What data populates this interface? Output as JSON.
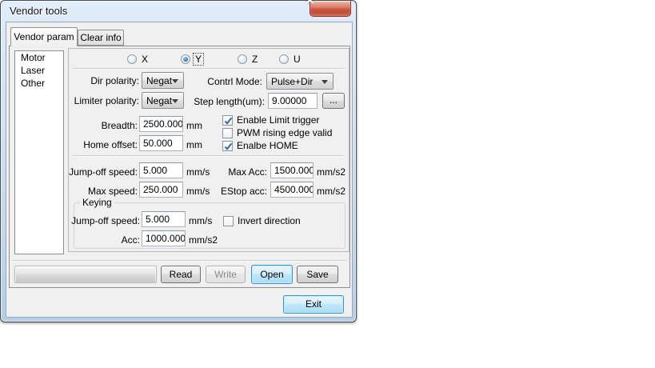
{
  "window": {
    "title": "Vendor tools"
  },
  "icons": {
    "close": "x-cross",
    "dropdown": "triangle-down",
    "checkbox_check": "checkmark"
  },
  "tabs": [
    {
      "label": "Vendor param"
    },
    {
      "label": "Clear info"
    }
  ],
  "sidebar": {
    "items": [
      "Motor",
      "Laser",
      "Other"
    ]
  },
  "axes": [
    {
      "label": "X",
      "selected": false
    },
    {
      "label": "Y",
      "selected": true
    },
    {
      "label": "Z",
      "selected": false
    },
    {
      "label": "U",
      "selected": false
    }
  ],
  "fields": {
    "dir_polarity": {
      "label": "Dir polarity:",
      "value": "Negat"
    },
    "contrl_mode": {
      "label": "Contrl Mode:",
      "value": "Pulse+Dir"
    },
    "limiter_polarity": {
      "label": "Limiter polarity:",
      "value": "Negat"
    },
    "step_length": {
      "label": "Step length(um):",
      "value": "9.00000",
      "browse": "..."
    },
    "breadth": {
      "label": "Breadth:",
      "value": "2500.000",
      "unit": "mm"
    },
    "home_offset": {
      "label": "Home offset:",
      "value": "50.000",
      "unit": "mm"
    },
    "jump_off_speed": {
      "label": "Jump-off speed:",
      "value": "5.000",
      "unit": "mm/s"
    },
    "max_speed": {
      "label": "Max speed:",
      "value": "250.000",
      "unit": "mm/s"
    },
    "max_acc": {
      "label": "Max Acc:",
      "value": "1500.000",
      "unit": "mm/s2"
    },
    "estop_acc": {
      "label": "EStop acc:",
      "value": "4500.000",
      "unit": "mm/s2"
    }
  },
  "checkboxes": {
    "enable_limit_trigger": {
      "label": "Enable Limit trigger",
      "checked": true
    },
    "pwm_rising_edge": {
      "label": "PWM rising edge valid",
      "checked": false
    },
    "enable_home": {
      "label": "Enalbe HOME",
      "checked": true
    }
  },
  "keying": {
    "title": "Keying",
    "jump_off_speed": {
      "label": "Jump-off speed:",
      "value": "5.000",
      "unit": "mm/s"
    },
    "acc": {
      "label": "Acc:",
      "value": "1000.000",
      "unit": "mm/s2"
    },
    "invert_direction": {
      "label": "Invert direction",
      "checked": false
    }
  },
  "buttons": {
    "read": "Read",
    "write": "Write",
    "open": "Open",
    "save": "Save",
    "exit": "Exit"
  },
  "colors": {
    "accent_focus": "#2d95d8",
    "close_button": "#cc5a43",
    "titlebar": "#cfe2f3",
    "client_bg": "#f0f0f0"
  }
}
